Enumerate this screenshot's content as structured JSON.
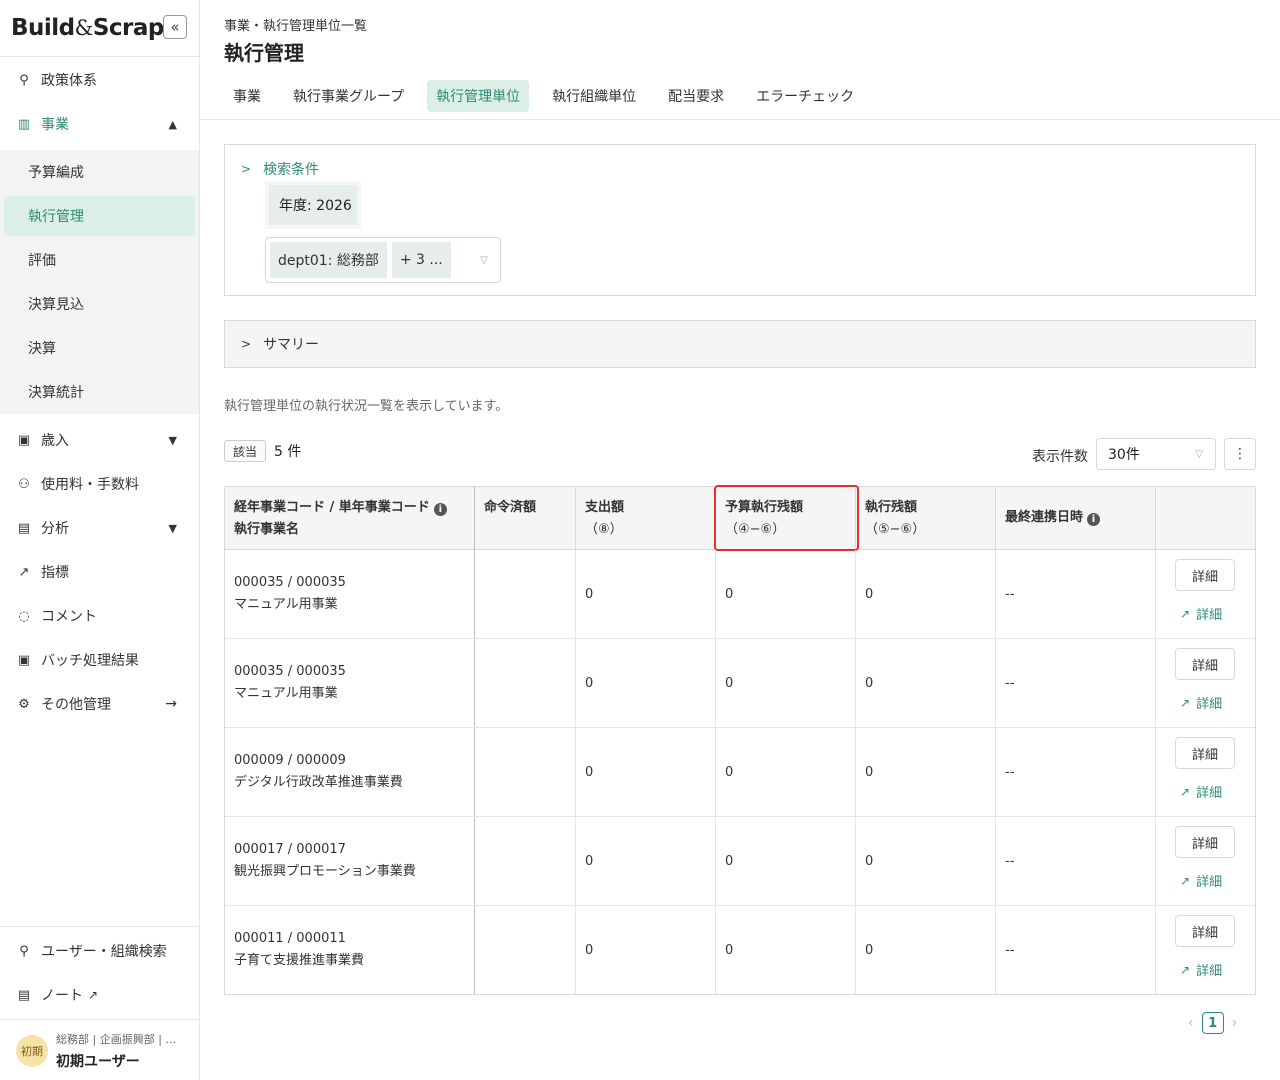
{
  "app": {
    "logo_part1": "Build",
    "logo_amp": "&",
    "logo_part2": "Scrap",
    "collapse_icon": "«"
  },
  "sidebar": {
    "items": [
      {
        "label": "政策体系",
        "icon": "⚲"
      },
      {
        "label": "事業",
        "icon": "▥"
      },
      {
        "label": "歳入",
        "icon": "▣"
      },
      {
        "label": "使用料・手数料",
        "icon": "⚇"
      },
      {
        "label": "分析",
        "icon": "▤"
      },
      {
        "label": "指標",
        "icon": "↗"
      },
      {
        "label": "コメント",
        "icon": "◌"
      },
      {
        "label": "バッチ処理結果",
        "icon": "▣"
      },
      {
        "label": "その他管理",
        "icon": "⚙"
      }
    ],
    "sub_items": [
      "予算編成",
      "執行管理",
      "評価",
      "決算見込",
      "決算",
      "決算統計"
    ],
    "bottom_items": [
      {
        "label": "ユーザー・組織検索",
        "icon": "⚲"
      },
      {
        "label": "ノート",
        "icon": "▤"
      }
    ],
    "user": {
      "avatar": "初期",
      "dept": "総務部 | 企画振興部 | …",
      "name": "初期ユーザー"
    }
  },
  "header": {
    "breadcrumb": "事業・執行管理単位一覧",
    "title": "執行管理",
    "tabs": [
      "事業",
      "執行事業グループ",
      "執行管理単位",
      "執行組織単位",
      "配当要求",
      "エラーチェック"
    ]
  },
  "search": {
    "title": "検索条件",
    "year_chip": "年度: 2026",
    "dept_chip": "dept01: 総務部",
    "more_chip": "+ 3 ..."
  },
  "summary": {
    "title": "サマリー"
  },
  "list": {
    "description": "執行管理単位の執行状況一覧を表示しています。",
    "count_badge": "該当",
    "count_text": "5 件",
    "per_page_label": "表示件数",
    "per_page_value": "30件",
    "columns": {
      "c1_line1": "経年事業コード / 単年事業コード",
      "c1_line2": "執行事業名",
      "c2": "命令済額",
      "c3_line1": "支出額",
      "c3_line2": "（⑧）",
      "c4_line1": "予算執行残額",
      "c4_line2": "（④−⑥）",
      "c5_line1": "執行残額",
      "c5_line2": "（⑤−⑥）",
      "c6": "最終連携日時"
    },
    "rows": [
      {
        "code": "000035 / 000035",
        "name": "マニュアル用事業",
        "spent": "0",
        "budget_remain": "0",
        "exec_remain": "0",
        "last_sync": "--"
      },
      {
        "code": "000035 / 000035",
        "name": "マニュアル用事業",
        "spent": "0",
        "budget_remain": "0",
        "exec_remain": "0",
        "last_sync": "--"
      },
      {
        "code": "000009 / 000009",
        "name": "デジタル行政改革推進事業費",
        "spent": "0",
        "budget_remain": "0",
        "exec_remain": "0",
        "last_sync": "--"
      },
      {
        "code": "000017 / 000017",
        "name": "観光振興プロモーション事業費",
        "spent": "0",
        "budget_remain": "0",
        "exec_remain": "0",
        "last_sync": "--"
      },
      {
        "code": "000011 / 000011",
        "name": "子育て支援推進事業費",
        "spent": "0",
        "budget_remain": "0",
        "exec_remain": "0",
        "last_sync": "--"
      }
    ],
    "detail_button": "詳細",
    "detail_link": "詳細",
    "page": "1"
  },
  "colors": {
    "accent": "#2e8b74",
    "highlight": "#e03030"
  }
}
